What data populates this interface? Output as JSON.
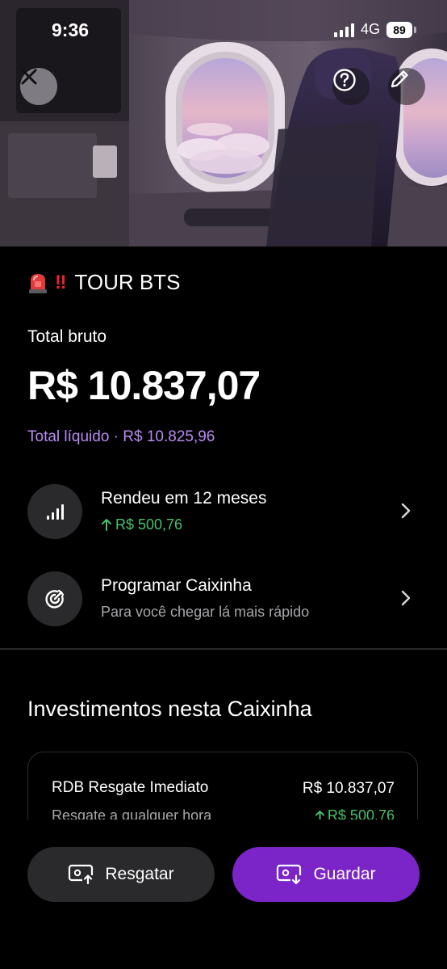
{
  "status_bar": {
    "time": "9:36",
    "network": "4G",
    "battery": "89"
  },
  "hero": {
    "image_subject": "airplane-cabin-window-icon"
  },
  "header": {
    "title": "TOUR BTS",
    "title_emoji": [
      "rotating-light-icon",
      "double-exclamation-icon"
    ],
    "close_icon": "close-icon",
    "help_icon": "help-icon",
    "edit_icon": "pencil-icon"
  },
  "summary": {
    "total_label": "Total bruto",
    "total_value": "R$ 10.837,07",
    "net_text": "Total líquido · R$ 10.825,96"
  },
  "rows": [
    {
      "title": "Rendeu em 12 meses",
      "subtitle": "R$ 500,76",
      "icon": "bar-chart-icon"
    },
    {
      "title": "Programar Caixinha",
      "subtitle": "Para você chegar lá mais rápido",
      "icon": "target-icon"
    }
  ],
  "investments": {
    "title": "Investimentos nesta Caixinha",
    "items": [
      {
        "name": "RDB Resgate Imediato",
        "amount": "R$ 10.837,07",
        "subtitle": "Resgate a qualquer hora",
        "yield": "R$ 500,76"
      }
    ]
  },
  "actions": {
    "withdraw_label": "Resgatar",
    "save_label": "Guardar"
  },
  "colors": {
    "accent": "#7b25c8",
    "accent_text": "#b88bf2",
    "positive": "#49c06b",
    "surface": "#2a2a2c",
    "background": "#000000"
  }
}
